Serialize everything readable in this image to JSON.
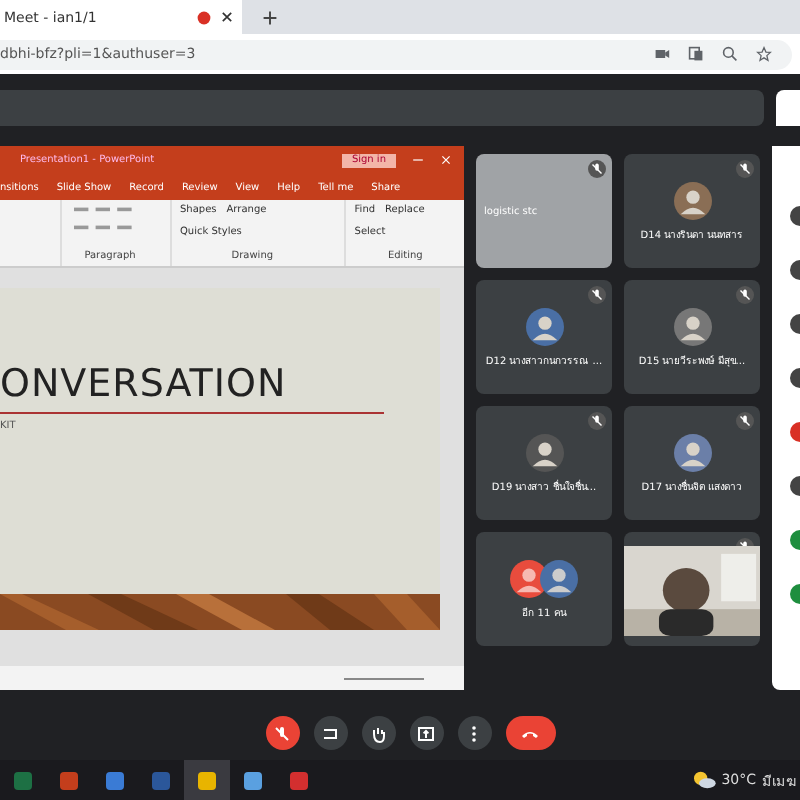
{
  "browser": {
    "tab_title": "Meet - ian1/1",
    "url": "dbhi-bfz?pli=1&authuser=3"
  },
  "presentation": {
    "app_title": "Presentation1 - PowerPoint",
    "sign_in": "Sign in",
    "ribbon_tabs": [
      "nsitions",
      "Slide Show",
      "Record",
      "Review",
      "View",
      "Help",
      "Tell me",
      "Share"
    ],
    "ribbon_groups": [
      {
        "label": "Paragraph"
      },
      {
        "label": "Drawing",
        "items": [
          "Shapes",
          "Arrange",
          "Quick Styles"
        ]
      },
      {
        "label": "Editing",
        "items": [
          "Find",
          "Replace",
          "Select"
        ]
      }
    ],
    "slide": {
      "title": "ONVERSATION",
      "subtitle": "KIT"
    }
  },
  "tiles": [
    {
      "kind": "screen",
      "name": "logistic stc",
      "muted": true
    },
    {
      "kind": "avatar",
      "name": "D14 นางรินดา นนทสาร",
      "muted": true
    },
    {
      "kind": "avatar",
      "name": "D12 นางสาวกนกวรรณ ...",
      "muted": true
    },
    {
      "kind": "avatar",
      "name": "D15 นายวีระพงษ์ มีสุข...",
      "muted": true
    },
    {
      "kind": "avatar",
      "name": "D19 นางสาว ชื่นใจชื่น...",
      "muted": true
    },
    {
      "kind": "avatar",
      "name": "D17 นางชื่นจิต แสงดาว",
      "muted": true
    },
    {
      "kind": "others",
      "name": "อีก 11 คน",
      "muted": false
    },
    {
      "kind": "video",
      "muted": true
    }
  ],
  "controls": [
    {
      "kind": "mic",
      "off": true
    },
    {
      "kind": "captions",
      "off": false
    },
    {
      "kind": "hand",
      "off": false
    },
    {
      "kind": "present",
      "off": false
    },
    {
      "kind": "more",
      "off": false
    },
    {
      "kind": "end"
    }
  ],
  "taskbar": {
    "apps": [
      {
        "kind": "excel",
        "active": false
      },
      {
        "kind": "powerpoint",
        "active": false
      },
      {
        "kind": "paint",
        "active": false
      },
      {
        "kind": "word",
        "active": false
      },
      {
        "kind": "chrome",
        "active": true
      },
      {
        "kind": "photos",
        "active": false
      },
      {
        "kind": "pdf",
        "active": false
      }
    ],
    "temperature": "30°C",
    "weather": "มีเมฆ"
  }
}
